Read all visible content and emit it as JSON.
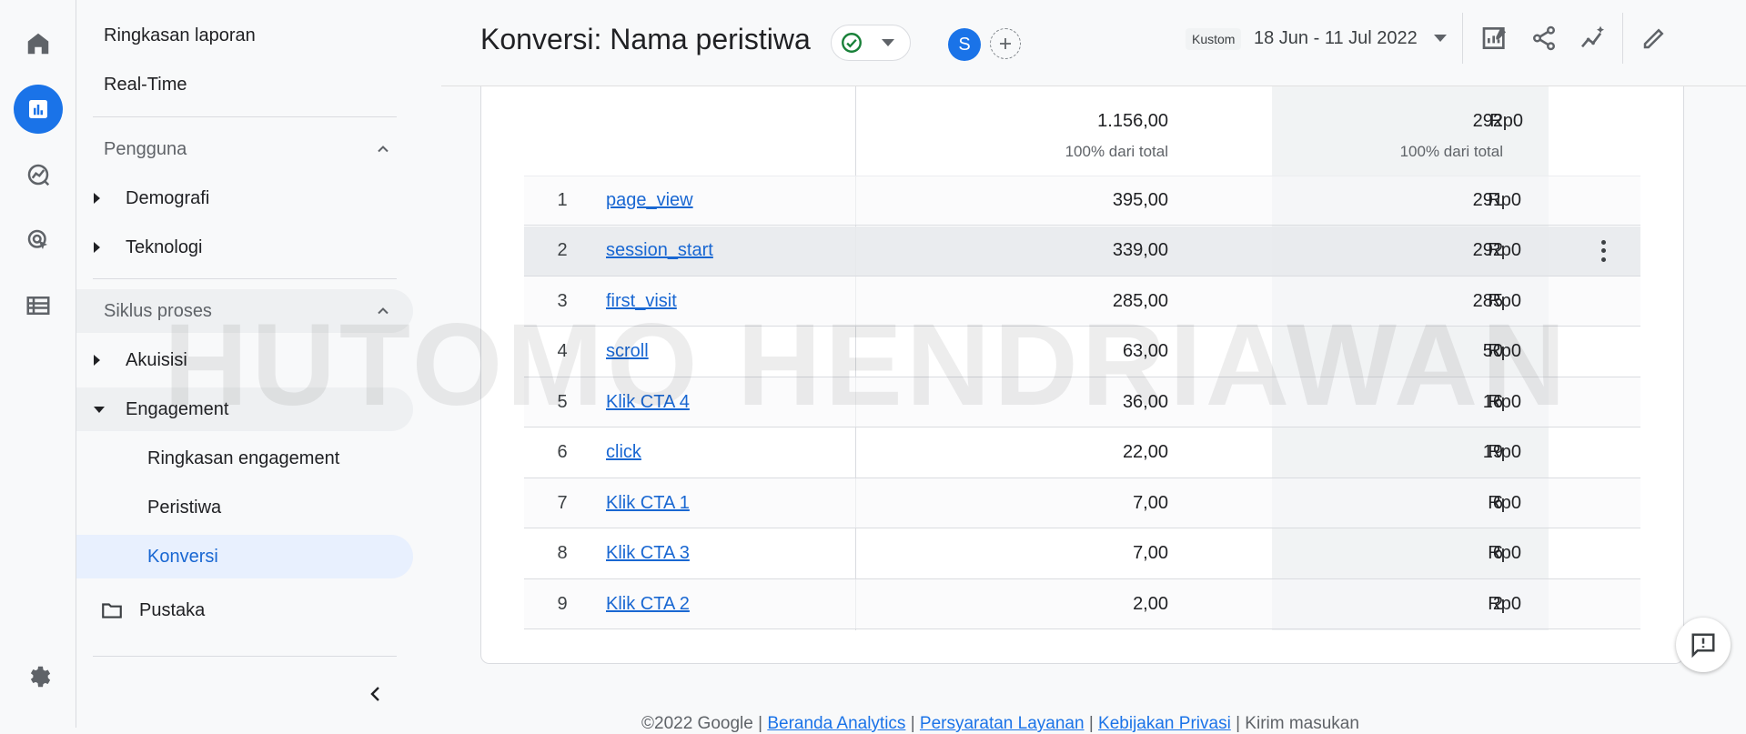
{
  "rail": {
    "items": [
      "home-icon",
      "reports-icon",
      "explore-icon",
      "advertising-icon",
      "configure-icon",
      "settings-icon"
    ],
    "accent": "#1a73e8"
  },
  "sidenav": {
    "report_snapshot": "Ringkasan laporan",
    "realtime": "Real-Time",
    "users_section": "Pengguna",
    "demographics": "Demografi",
    "tech": "Teknologi",
    "lifecycle_section": "Siklus proses",
    "acquisition": "Akuisisi",
    "engagement": "Engagement",
    "engagement_overview": "Ringkasan engagement",
    "events": "Peristiwa",
    "conversions": "Konversi",
    "library": "Pustaka"
  },
  "header": {
    "title": "Konversi: Nama peristiwa",
    "avatar_letter": "S",
    "date_chip": "Kustom",
    "date_range": "18 Jun - 11 Jul 2022"
  },
  "table": {
    "totals": {
      "conversions": "1.156,00",
      "conversions_sub": "100% dari total",
      "users": "292",
      "users_sub": "100% dari total",
      "revenue": "Rp0"
    },
    "rows": [
      {
        "idx": "1",
        "name": "page_view",
        "conversions": "395,00",
        "users": "291",
        "revenue": "Rp0"
      },
      {
        "idx": "2",
        "name": "session_start",
        "conversions": "339,00",
        "users": "292",
        "revenue": "Rp0"
      },
      {
        "idx": "3",
        "name": "first_visit",
        "conversions": "285,00",
        "users": "285",
        "revenue": "Rp0"
      },
      {
        "idx": "4",
        "name": "scroll",
        "conversions": "63,00",
        "users": "50",
        "revenue": "Rp0"
      },
      {
        "idx": "5",
        "name": "Klik CTA 4",
        "conversions": "36,00",
        "users": "16",
        "revenue": "Rp0"
      },
      {
        "idx": "6",
        "name": "click",
        "conversions": "22,00",
        "users": "19",
        "revenue": "Rp0"
      },
      {
        "idx": "7",
        "name": "Klik CTA 1",
        "conversions": "7,00",
        "users": "6",
        "revenue": "Rp0"
      },
      {
        "idx": "8",
        "name": "Klik CTA 3",
        "conversions": "7,00",
        "users": "6",
        "revenue": "Rp0"
      },
      {
        "idx": "9",
        "name": "Klik CTA 2",
        "conversions": "2,00",
        "users": "2",
        "revenue": "Rp0"
      }
    ]
  },
  "watermark": "HUTOMO HENDRIAWAN",
  "footer": {
    "copyright": "©2022 Google",
    "sep1": " | ",
    "link1": "Beranda Analytics",
    "sep2": " | ",
    "link2": "Persyaratan Layanan",
    "sep3": " | ",
    "link3": "Kebijakan Privasi",
    "sep4": " | ",
    "feedback": "Kirim masukan"
  }
}
